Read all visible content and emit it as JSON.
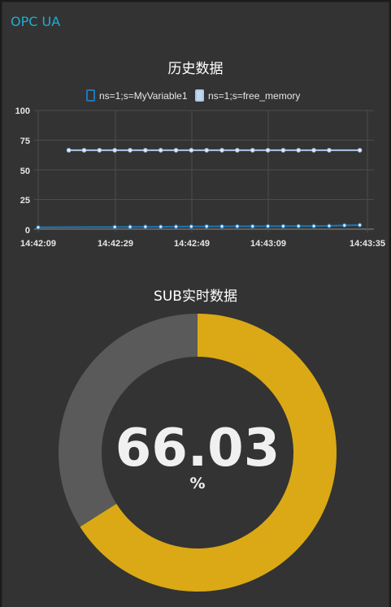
{
  "group": {
    "title": "OPC UA"
  },
  "chart": {
    "title": "历史数据",
    "legend": [
      {
        "name": "ns=1;s=MyVariable1",
        "color": "#1f77b4"
      },
      {
        "name": "ns=1;s=free_memory",
        "color": "#aec7e8"
      }
    ],
    "y_ticks": [
      "100",
      "75",
      "50",
      "25",
      "0"
    ],
    "x_ticks": [
      "14:42:09",
      "14:42:29",
      "14:42:49",
      "14:43:09",
      "14:43:35"
    ]
  },
  "chart_data": {
    "type": "line",
    "title": "历史数据",
    "xlabel": "",
    "ylabel": "",
    "ylim": [
      0,
      100
    ],
    "grid": true,
    "legend_position": "top",
    "x_ticks": [
      "14:42:09",
      "14:42:29",
      "14:42:49",
      "14:43:09",
      "14:43:35"
    ],
    "series": [
      {
        "name": "ns=1;s=MyVariable1",
        "color": "#1f77b4",
        "x_seconds": [
          0,
          20,
          24,
          28,
          32,
          36,
          40,
          44,
          48,
          52,
          56,
          60,
          64,
          68,
          72,
          76,
          80,
          84
        ],
        "values": [
          1.5,
          1.8,
          1.9,
          2.0,
          2.0,
          2.1,
          2.2,
          2.3,
          2.3,
          2.4,
          2.4,
          2.5,
          2.5,
          2.6,
          2.6,
          2.7,
          3.2,
          3.4
        ]
      },
      {
        "name": "ns=1;s=free_memory",
        "color": "#aec7e8",
        "x_seconds": [
          8,
          12,
          16,
          20,
          24,
          28,
          32,
          36,
          40,
          44,
          48,
          52,
          56,
          60,
          64,
          68,
          72,
          76,
          84
        ],
        "values": [
          66.5,
          66.5,
          66.5,
          66.5,
          66.5,
          66.5,
          66.5,
          66.5,
          66.5,
          66.5,
          66.5,
          66.5,
          66.5,
          66.5,
          66.5,
          66.5,
          66.5,
          66.5,
          66.5
        ]
      }
    ]
  },
  "gauge": {
    "title": "SUB实时数据",
    "value": "66.03",
    "value_number": 66.03,
    "min": 0,
    "max": 100,
    "unit": "%",
    "fill_color": "#daa915",
    "track_color": "#5a5a5a"
  }
}
